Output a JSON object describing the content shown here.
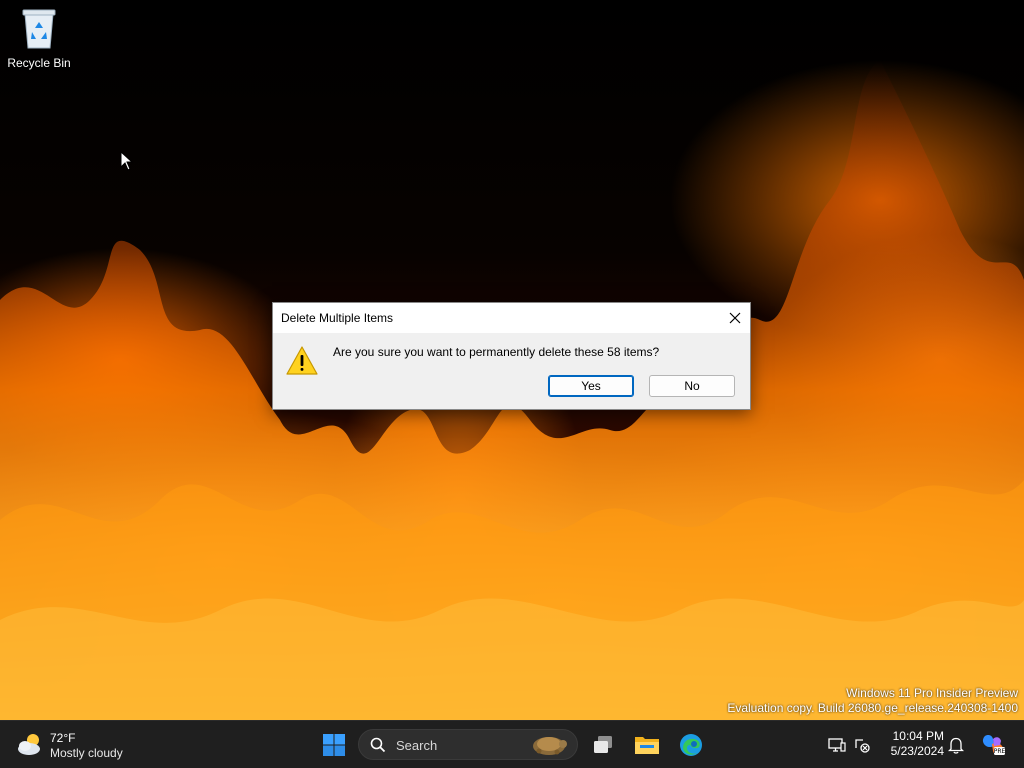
{
  "desktop": {
    "icons": [
      {
        "label": "Recycle Bin",
        "icon": "recycle-bin-icon"
      }
    ],
    "watermark": {
      "line1": "Windows 11 Pro Insider Preview",
      "line2": "Evaluation copy. Build 26080.ge_release.240308-1400"
    }
  },
  "dialog": {
    "title": "Delete Multiple Items",
    "message": "Are you sure you want to permanently delete these 58 items?",
    "icon": "warning-icon",
    "buttons": {
      "yes": "Yes",
      "no": "No"
    },
    "close_icon": "close-icon"
  },
  "taskbar": {
    "weather": {
      "temp": "72°F",
      "condition": "Mostly cloudy",
      "icon": "partly-cloudy-icon"
    },
    "start_icon": "windows-start-icon",
    "search": {
      "placeholder": "Search",
      "icon": "search-icon"
    },
    "pinned": [
      "task-view-icon",
      "file-explorer-icon",
      "edge-icon"
    ],
    "tray": [
      "display-icon",
      "network-disconnected-icon",
      "notification-bell-icon",
      "copilot-icon"
    ],
    "clock": {
      "time": "10:04 PM",
      "date": "5/23/2024"
    }
  },
  "colors": {
    "taskbar_bg": "#1f1f1f",
    "dialog_bg": "#f0f0f0",
    "accent": "#0067c0"
  }
}
